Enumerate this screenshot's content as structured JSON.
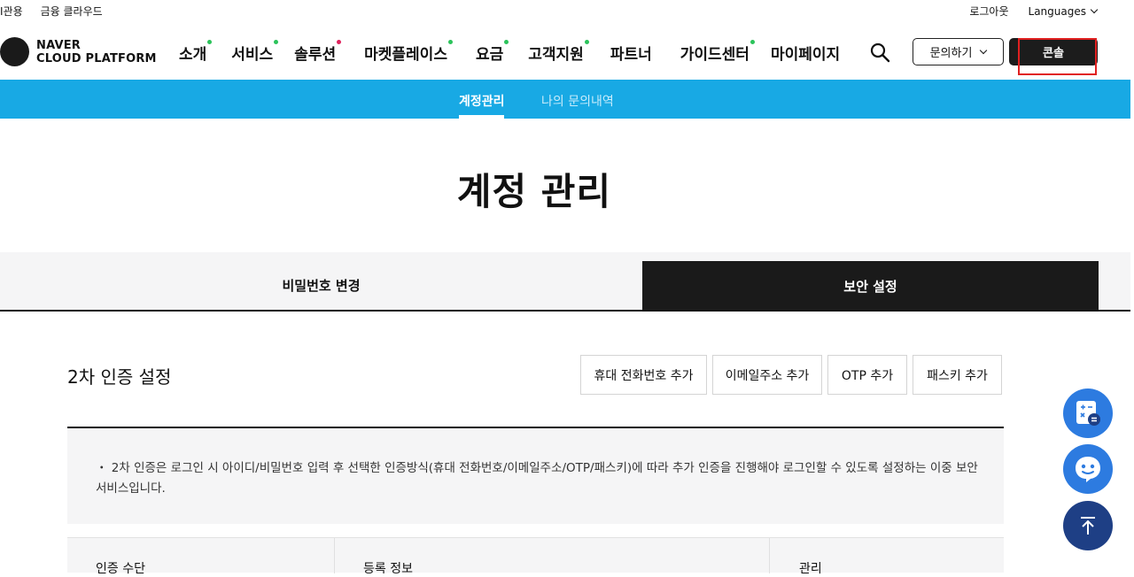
{
  "topbar": {
    "left_links": [
      "I관용",
      "금융 클라우드"
    ],
    "logout": "로그아웃",
    "languages": "Languages"
  },
  "brand": {
    "line1": "NAVER",
    "line2": "CLOUD PLATFORM"
  },
  "menu": [
    {
      "label": "소개",
      "marker": "#2bc35a"
    },
    {
      "label": "서비스",
      "marker": "#2bc35a"
    },
    {
      "label": "솔루션",
      "marker": "#e0245e"
    },
    {
      "label": "마켓플레이스",
      "marker": "#2bc35a"
    },
    {
      "label": "요금",
      "marker": "#2bc35a"
    },
    {
      "label": "고객지원",
      "marker": "#2bc35a"
    },
    {
      "label": "파트너",
      "marker": ""
    },
    {
      "label": "가이드센터",
      "marker": "#2bc35a"
    },
    {
      "label": "마이페이지",
      "marker": ""
    }
  ],
  "header_buttons": {
    "inquiry": "문의하기",
    "console": "콘솔"
  },
  "subnav": {
    "active": "계정관리",
    "inactive": "나의 문의내역"
  },
  "page_title": "계정 관리",
  "tabs": {
    "password": "비밀번호 변경",
    "security": "보안 설정"
  },
  "section": {
    "title": "2차 인증 설정",
    "buttons": [
      "휴대 전화번호 추가",
      "이메일주소 추가",
      "OTP 추가",
      "패스키 추가"
    ]
  },
  "info": {
    "bullet": "・",
    "text": "2차 인증은 로그인 시 아이디/비밀번호 입력 후 선택한 인증방식(휴대 전화번호/이메일주소/OTP/패스키)에 따라 추가 인증을 진행해야 로그인할 수 있도록 설정하는 이중 보안 서비스입니다."
  },
  "table": {
    "columns": [
      "인증 수단",
      "등록 정보",
      "관리"
    ]
  },
  "colors": {
    "accent": "#18a9e4",
    "dark": "#1a1a1a",
    "fab": "#2d7be0",
    "fab_top": "#1e3f85",
    "highlight": "#e02020"
  }
}
